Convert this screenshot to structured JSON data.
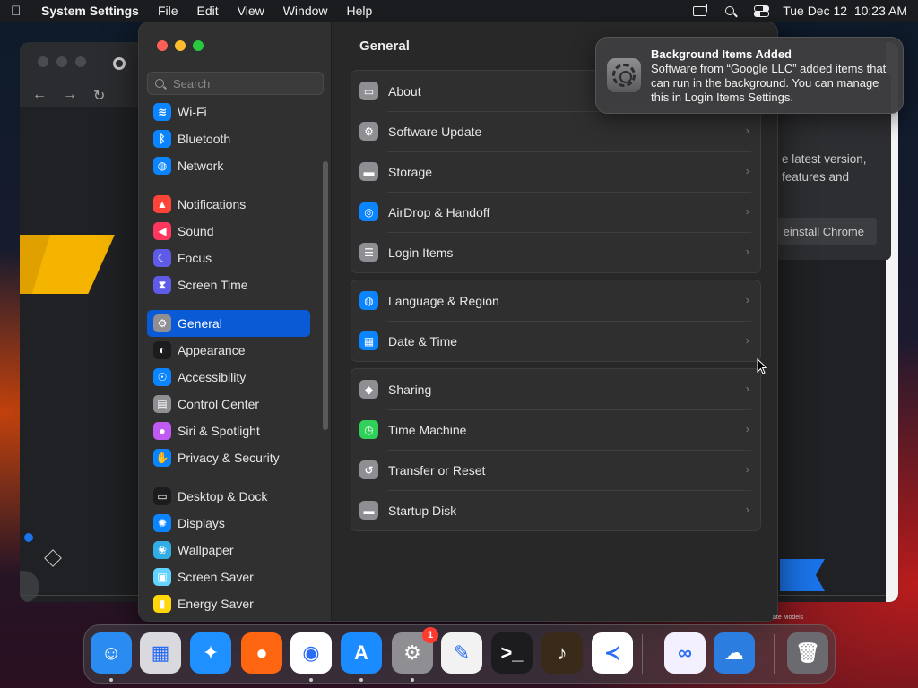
{
  "menubar": {
    "app_name": "System Settings",
    "menus": [
      "File",
      "Edit",
      "View",
      "Window",
      "Help"
    ],
    "datetime": "Tue Dec 12  10:23 AM"
  },
  "chrome_popup": {
    "text": "e latest version,\nfeatures and",
    "button": "einstall Chrome",
    "close": "✕"
  },
  "chrome_bottom_text": "ate Models",
  "sidebar": {
    "search_placeholder": "Search",
    "items": [
      {
        "label": "Wi-Fi",
        "icon": "wifi-icon",
        "color": "#0a84ff",
        "glyph": "≋"
      },
      {
        "label": "Bluetooth",
        "icon": "bluetooth-icon",
        "color": "#0a84ff",
        "glyph": "ᛒ"
      },
      {
        "label": "Network",
        "icon": "network-icon",
        "color": "#0a84ff",
        "glyph": "◍"
      },
      {
        "label": "Notifications",
        "icon": "notifications-icon",
        "color": "#ff453a",
        "glyph": "▲"
      },
      {
        "label": "Sound",
        "icon": "sound-icon",
        "color": "#ff375f",
        "glyph": "◀"
      },
      {
        "label": "Focus",
        "icon": "focus-icon",
        "color": "#5e5ce6",
        "glyph": "☾"
      },
      {
        "label": "Screen Time",
        "icon": "screen-time-icon",
        "color": "#5e5ce6",
        "glyph": "⧗"
      },
      {
        "label": "General",
        "icon": "general-icon",
        "color": "#8e8e93",
        "glyph": "⚙"
      },
      {
        "label": "Appearance",
        "icon": "appearance-icon",
        "color": "#1c1c1e",
        "glyph": "◐"
      },
      {
        "label": "Accessibility",
        "icon": "accessibility-icon",
        "color": "#0a84ff",
        "glyph": "☉"
      },
      {
        "label": "Control Center",
        "icon": "control-center-icon",
        "color": "#8e8e93",
        "glyph": "▤"
      },
      {
        "label": "Siri & Spotlight",
        "icon": "siri-icon",
        "color": "#bf5af2",
        "glyph": "●"
      },
      {
        "label": "Privacy & Security",
        "icon": "privacy-icon",
        "color": "#0a84ff",
        "glyph": "✋"
      },
      {
        "label": "Desktop & Dock",
        "icon": "desktop-dock-icon",
        "color": "#1c1c1e",
        "glyph": "▭"
      },
      {
        "label": "Displays",
        "icon": "displays-icon",
        "color": "#0a84ff",
        "glyph": "✺"
      },
      {
        "label": "Wallpaper",
        "icon": "wallpaper-icon",
        "color": "#32ade6",
        "glyph": "❀"
      },
      {
        "label": "Screen Saver",
        "icon": "screen-saver-icon",
        "color": "#64d2ff",
        "glyph": "▣"
      },
      {
        "label": "Energy Saver",
        "icon": "energy-saver-icon",
        "color": "#ffd60a",
        "glyph": "▮"
      }
    ],
    "active": "General"
  },
  "main": {
    "title": "General",
    "groups": [
      [
        {
          "label": "About",
          "icon": "about-icon",
          "color": "#8e8e93",
          "glyph": "▭"
        },
        {
          "label": "Software Update",
          "icon": "software-update-icon",
          "color": "#8e8e93",
          "glyph": "⚙"
        },
        {
          "label": "Storage",
          "icon": "storage-icon",
          "color": "#8e8e93",
          "glyph": "▬"
        },
        {
          "label": "AirDrop & Handoff",
          "icon": "airdrop-icon",
          "color": "#0a84ff",
          "glyph": "◎"
        },
        {
          "label": "Login Items",
          "icon": "login-items-icon",
          "color": "#8e8e93",
          "glyph": "☰"
        }
      ],
      [
        {
          "label": "Language & Region",
          "icon": "language-region-icon",
          "color": "#0a84ff",
          "glyph": "◍"
        },
        {
          "label": "Date & Time",
          "icon": "date-time-icon",
          "color": "#0a84ff",
          "glyph": "▦"
        }
      ],
      [
        {
          "label": "Sharing",
          "icon": "sharing-icon",
          "color": "#8e8e93",
          "glyph": "◆"
        },
        {
          "label": "Time Machine",
          "icon": "time-machine-icon",
          "color": "#30d158",
          "glyph": "◷"
        },
        {
          "label": "Transfer or Reset",
          "icon": "transfer-reset-icon",
          "color": "#8e8e93",
          "glyph": "↺"
        },
        {
          "label": "Startup Disk",
          "icon": "startup-disk-icon",
          "color": "#8e8e93",
          "glyph": "▬"
        }
      ]
    ]
  },
  "notification": {
    "title": "Background Items Added",
    "body": "Software from “Google LLC” added items that can run in the background. You can manage this in Login Items Settings."
  },
  "dock": {
    "items": [
      {
        "name": "finder-icon",
        "color": "#2a8cf0",
        "glyph": "☺",
        "dot": true
      },
      {
        "name": "launchpad-icon",
        "color": "#d9d9de",
        "glyph": "▦",
        "dot": false
      },
      {
        "name": "safari-icon",
        "color": "#1e90ff",
        "glyph": "✦",
        "dot": false
      },
      {
        "name": "firefox-icon",
        "color": "#ff6611",
        "glyph": "●",
        "dot": false
      },
      {
        "name": "chrome-icon",
        "color": "#ffffff",
        "glyph": "◉",
        "dot": true
      },
      {
        "name": "app-store-icon",
        "color": "#1a8cff",
        "glyph": "A",
        "dot": true
      },
      {
        "name": "system-settings-icon",
        "color": "#8e8e93",
        "glyph": "⚙",
        "dot": true,
        "badge": "1"
      },
      {
        "name": "textedit-icon",
        "color": "#f2f2f2",
        "glyph": "✎",
        "dot": false
      },
      {
        "name": "terminal-icon",
        "color": "#1c1c1e",
        "glyph": ">_",
        "dot": false
      },
      {
        "name": "garageband-icon",
        "color": "#3a2a1a",
        "glyph": "♪",
        "dot": false
      },
      {
        "name": "vscode-icon",
        "color": "#ffffff",
        "glyph": "≺",
        "dot": false
      },
      {
        "name": "visual-studio-icon",
        "color": "#f3f0ff",
        "glyph": "∞",
        "dot": false
      },
      {
        "name": "weather-icon",
        "color": "#2b7de0",
        "glyph": "☁",
        "dot": false
      },
      {
        "name": "trash-icon",
        "color": "#6b6b6f",
        "glyph": "🗑",
        "dot": false
      }
    ]
  }
}
